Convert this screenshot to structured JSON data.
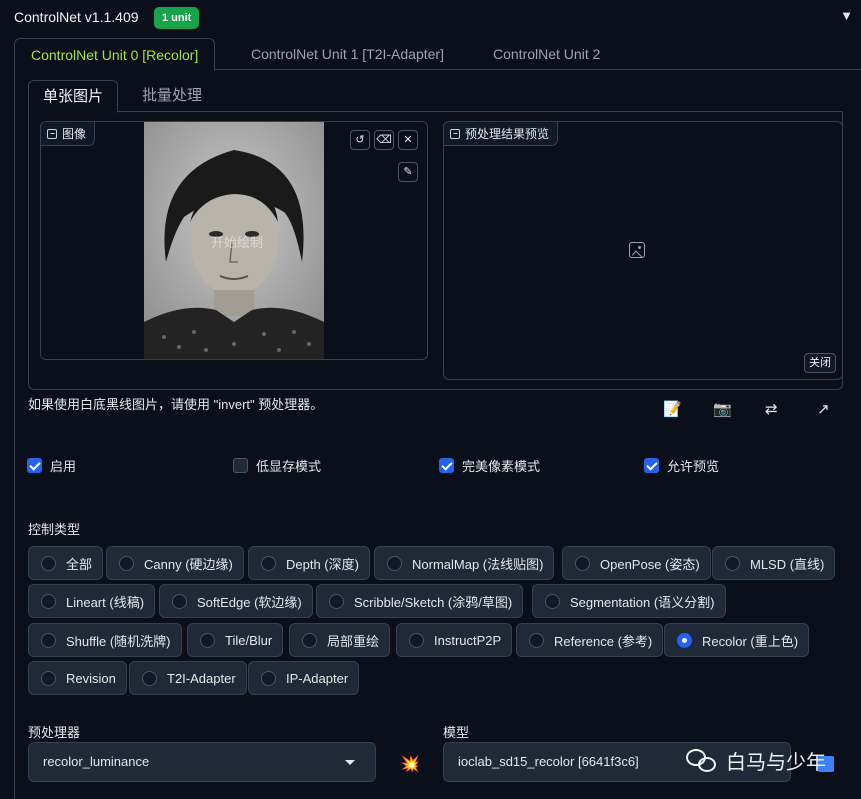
{
  "header": {
    "title": "ControlNet v1.1.409",
    "badge": "1 unit"
  },
  "unit_tabs": [
    "ControlNet Unit 0 [Recolor]",
    "ControlNet Unit 1 [T2I-Adapter]",
    "ControlNet Unit 2"
  ],
  "image_tabs": [
    "单张图片",
    "批量处理"
  ],
  "image_box": {
    "label": "图像",
    "watermark": "开始绘制"
  },
  "preview_box": {
    "label": "预处理结果预览",
    "close_label": "关闭"
  },
  "hint": "如果使用白底黑线图片，请使用 \"invert\" 预处理器。",
  "tool_icons": [
    "📝",
    "📷",
    "⇄",
    "↗"
  ],
  "checkboxes": [
    {
      "label": "启用",
      "checked": true
    },
    {
      "label": "低显存模式",
      "checked": false
    },
    {
      "label": "完美像素模式",
      "checked": true
    },
    {
      "label": "允许预览",
      "checked": true
    }
  ],
  "control_type": {
    "label": "控制类型",
    "options": [
      "全部",
      "Canny (硬边缘)",
      "Depth (深度)",
      "NormalMap (法线贴图)",
      "OpenPose (姿态)",
      "MLSD (直线)",
      "Lineart (线稿)",
      "SoftEdge (软边缘)",
      "Scribble/Sketch (涂鸦/草图)",
      "Segmentation (语义分割)",
      "Shuffle (随机洗牌)",
      "Tile/Blur",
      "局部重绘",
      "InstructP2P",
      "Reference (参考)",
      "Recolor (重上色)",
      "Revision",
      "T2I-Adapter",
      "IP-Adapter"
    ],
    "selected": "Recolor (重上色)"
  },
  "preprocessor": {
    "label": "预处理器",
    "value": "recolor_luminance"
  },
  "model": {
    "label": "模型",
    "value": "ioclab_sd15_recolor [6641f3c6]"
  },
  "watermark_account": "白马与少年",
  "colors": {
    "accent": "#a3e635",
    "primary": "#2563eb",
    "badge": "#16a34a",
    "bg": "#0b0f19"
  }
}
